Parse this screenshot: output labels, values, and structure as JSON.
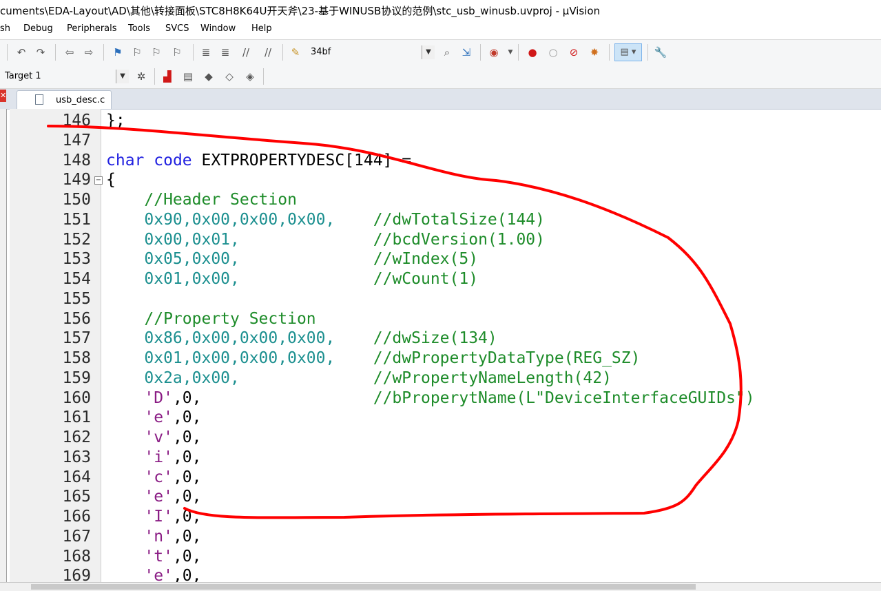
{
  "window": {
    "title": "cuments\\EDA-Layout\\AD\\其他\\转接面板\\STC8H8K64U开天斧\\23-基于WINUSB协议的范例\\stc_usb_winusb.uvproj - µVision"
  },
  "menu": [
    "sh",
    "Debug",
    "Peripherals",
    "Tools",
    "SVCS",
    "Window",
    "Help"
  ],
  "toolbar": {
    "find_combo_value": "34bf",
    "target_combo_value": "Target 1"
  },
  "tabs": [
    {
      "label": "usb_desc.c"
    }
  ],
  "colors": {
    "hex_literal": "#1b8f8f",
    "comment": "#1e8c2a",
    "keyword": "#2020e0",
    "char_literal": "#8a1c84",
    "annotation_stroke": "#ff0000"
  },
  "editor": {
    "lines": [
      {
        "num": "146",
        "text": "};"
      },
      {
        "num": "147",
        "text": ""
      },
      {
        "num": "148",
        "kw1": "char",
        "kw2": "code",
        "text": " EXTPROPERTYDESC[144] ="
      },
      {
        "num": "149",
        "text": "{"
      },
      {
        "num": "150",
        "comment": "//Header Section"
      },
      {
        "num": "151",
        "hex": "0x90,0x00,0x00,0x00,",
        "comment": "//dwTotalSize(144)"
      },
      {
        "num": "152",
        "hex": "0x00,0x01,",
        "comment": "//bcdVersion(1.00)"
      },
      {
        "num": "153",
        "hex": "0x05,0x00,",
        "comment": "//wIndex(5)"
      },
      {
        "num": "154",
        "hex": "0x01,0x00,",
        "comment": "//wCount(1)"
      },
      {
        "num": "155",
        "text": ""
      },
      {
        "num": "156",
        "comment": "//Property Section"
      },
      {
        "num": "157",
        "hex": "0x86,0x00,0x00,0x00,",
        "comment": "//dwSize(134)"
      },
      {
        "num": "158",
        "hex": "0x01,0x00,0x00,0x00,",
        "comment": "//dwPropertyDataType(REG_SZ)"
      },
      {
        "num": "159",
        "hex": "0x2a,0x00,",
        "comment": "//wPropertyNameLength(42)"
      },
      {
        "num": "160",
        "chr": "'D'",
        "rest": ",0,",
        "comment": "//bProperytName(L\"DeviceInterfaceGUIDs\")"
      },
      {
        "num": "161",
        "chr": "'e'",
        "rest": ",0,"
      },
      {
        "num": "162",
        "chr": "'v'",
        "rest": ",0,"
      },
      {
        "num": "163",
        "chr": "'i'",
        "rest": ",0,"
      },
      {
        "num": "164",
        "chr": "'c'",
        "rest": ",0,"
      },
      {
        "num": "165",
        "chr": "'e'",
        "rest": ",0,"
      },
      {
        "num": "166",
        "chr": "'I'",
        "rest": ",0,"
      },
      {
        "num": "167",
        "chr": "'n'",
        "rest": ",0,"
      },
      {
        "num": "168",
        "chr": "'t'",
        "rest": ",0,"
      },
      {
        "num": "169",
        "chr": "'e'",
        "rest": ",0,"
      }
    ]
  }
}
